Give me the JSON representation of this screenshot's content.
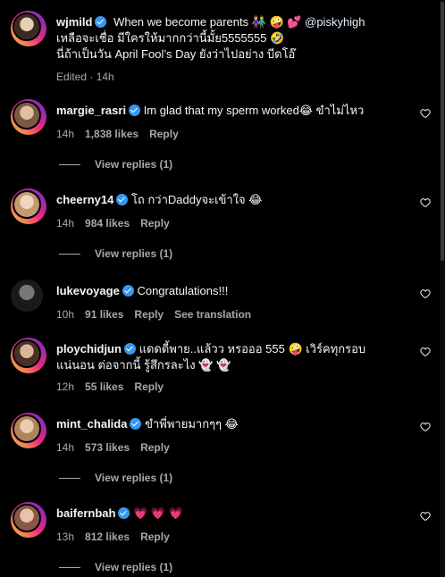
{
  "caption": {
    "username": "wjmild",
    "line1": "When we become parents 👫 🤪 💕",
    "mention": "@piskyhigh",
    "line2": "เหลือจะเชื่อ มีใครให้มากกว่านี้มั้ย5555555 🤣",
    "line3": "นี่ถ้าเป็นวัน April Fool’s Day ยังว่าไปอย่าง บีดโอ๊",
    "edited": "Edited · 14h"
  },
  "comments": [
    {
      "username": "margie_rasri",
      "text": "Im glad that my sperm worked😂 ขำไม่ไหว",
      "time": "14h",
      "likes": "1,838 likes",
      "reply": "Reply",
      "view_replies": "View replies (1)",
      "color": "#b08a6a"
    },
    {
      "username": "cheerny14",
      "text": "โถ กว่าDaddyจะเข้าใจ 😂",
      "time": "14h",
      "likes": "984 likes",
      "reply": "Reply",
      "view_replies": "View replies (1)",
      "color": "#d9b38c"
    },
    {
      "username": "lukevoyage",
      "text": "Congratulations!!!",
      "time": "10h",
      "likes": "91 likes",
      "reply": "Reply",
      "translation": "See translation",
      "color": "#333333"
    },
    {
      "username": "ploychidjun",
      "text": "แดดดี้พาย..แล้วว หรอออ 555 🤪 เวิร์คทุกรอบ",
      "text2": "แน่นอน ต่อจากนี้ รู้สึกรละไง 👻 👻",
      "time": "12h",
      "likes": "55 likes",
      "reply": "Reply",
      "color": "#6b4a3a"
    },
    {
      "username": "mint_chalida",
      "text": "ขำพี่พายมากๆๆ 😂",
      "time": "14h",
      "likes": "573 likes",
      "reply": "Reply",
      "view_replies": "View replies (1)",
      "color": "#c4946c"
    },
    {
      "username": "baifernbah",
      "text": "💗 💗 💗",
      "time": "13h",
      "likes": "812 likes",
      "reply": "Reply",
      "view_replies": "View replies (1)",
      "color": "#a07060"
    }
  ]
}
